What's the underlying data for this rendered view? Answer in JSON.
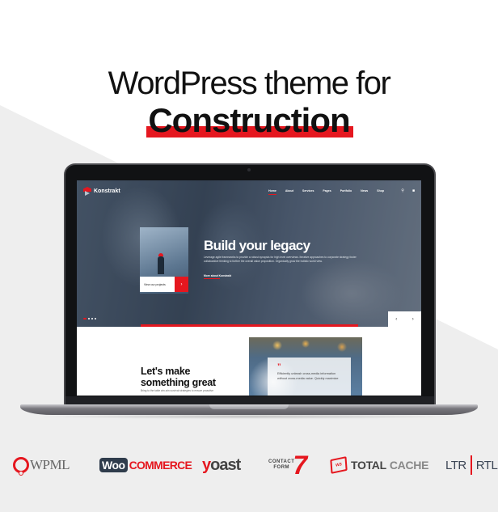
{
  "headline": {
    "line1": "WordPress theme for",
    "line2": "Construction"
  },
  "colors": {
    "accent": "#e5171f",
    "dark": "#111111",
    "background": "#eeeeee"
  },
  "site": {
    "logo_text": "Konstrakt",
    "nav": [
      {
        "label": "Home",
        "active": true
      },
      {
        "label": "About"
      },
      {
        "label": "Services"
      },
      {
        "label": "Pages"
      },
      {
        "label": "Portfolio"
      },
      {
        "label": "News"
      },
      {
        "label": "Shop"
      }
    ],
    "nav_icons": {
      "search": "search-icon",
      "cart": "cart-icon",
      "cart_count": "0"
    },
    "hero": {
      "title_prefix": "Build your",
      "title_highlight": "legacy",
      "description": "Leverage agile frameworks to provide a robust synopsis for high level overviews. Iterative approaches to corporate strategy foster collaborative thinking to further the overall value proposition. Organically grow the holistic world view.",
      "link_label": "More about Konstrakt",
      "project_button_label": "View our projects",
      "project_button_icon": "chevron-right-icon",
      "slide_prev": "‹",
      "slide_next": "›",
      "slides_total": 4,
      "slide_active": 1
    },
    "cta": {
      "title_line1": "Let's make",
      "title_line2": "something great",
      "description": "Bring to the table win-win survival strategies to ensure proactive"
    },
    "quote": {
      "mark": "”",
      "text": "Efficiently unleash cross-media information without cross-media value. Quickly maximize"
    }
  },
  "plugins": [
    {
      "name": "WPML",
      "text": "WPML"
    },
    {
      "name": "WooCommerce",
      "box": "Woo",
      "text": "COMMERCE"
    },
    {
      "name": "Yoast",
      "first": "y",
      "rest": "oast"
    },
    {
      "name": "Contact Form 7",
      "line1": "CONTACT",
      "line2": "FORM",
      "seven": "7"
    },
    {
      "name": "W3 Total Cache",
      "badge": "W3",
      "t1": "TOTAL",
      "t2": "CACHE"
    },
    {
      "name": "LTR RTL",
      "left": "LTR",
      "right": "RTL"
    }
  ]
}
